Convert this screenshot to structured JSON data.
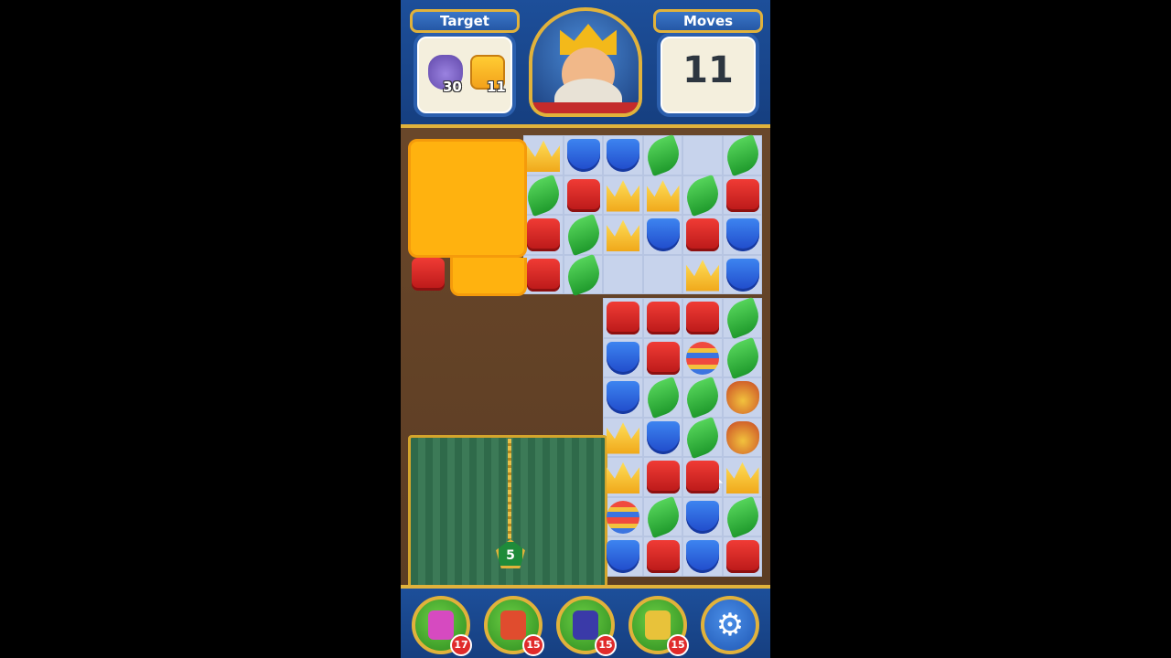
{
  "header": {
    "target_label": "Target",
    "moves_label": "Moves",
    "moves_value": "11",
    "targets": [
      {
        "icon": "vase-icon",
        "count": "30"
      },
      {
        "icon": "amber-tile-icon",
        "count": "11"
      }
    ],
    "avatar": "king-avatar"
  },
  "board": {
    "lock_count": "5",
    "pieces": [
      [
        "red",
        1,
        3
      ],
      [
        "crown",
        3,
        0
      ],
      [
        "blue",
        4,
        0
      ],
      [
        "blue",
        5,
        0
      ],
      [
        "green",
        6,
        0
      ],
      [
        "green",
        8,
        0
      ],
      [
        "green",
        3,
        1
      ],
      [
        "red",
        4,
        1
      ],
      [
        "crown",
        5,
        1
      ],
      [
        "crown",
        6,
        1
      ],
      [
        "green",
        7,
        1
      ],
      [
        "red",
        8,
        1
      ],
      [
        "red",
        3,
        2
      ],
      [
        "green",
        4,
        2
      ],
      [
        "crown",
        5,
        2
      ],
      [
        "blue",
        6,
        2
      ],
      [
        "red",
        7,
        2
      ],
      [
        "blue",
        8,
        2
      ],
      [
        "red",
        3,
        3
      ],
      [
        "green",
        4,
        3
      ],
      [
        "crown",
        7,
        3
      ],
      [
        "blue",
        8,
        3
      ],
      [
        "red",
        5,
        4
      ],
      [
        "red",
        6,
        4
      ],
      [
        "red",
        7,
        4
      ],
      [
        "green",
        8,
        4
      ],
      [
        "blue",
        5,
        5
      ],
      [
        "red",
        6,
        5
      ],
      [
        "rocket",
        7,
        5
      ],
      [
        "green",
        8,
        5
      ],
      [
        "blue",
        5,
        6
      ],
      [
        "green",
        6,
        6
      ],
      [
        "green",
        7,
        6
      ],
      [
        "jester",
        8,
        6
      ],
      [
        "crown",
        5,
        7
      ],
      [
        "blue",
        6,
        7
      ],
      [
        "green",
        7,
        7
      ],
      [
        "jester",
        8,
        7
      ],
      [
        "crown",
        5,
        8
      ],
      [
        "red",
        6,
        8
      ],
      [
        "red",
        7,
        8
      ],
      [
        "crown",
        8,
        8
      ],
      [
        "rocket",
        5,
        9
      ],
      [
        "green",
        6,
        9
      ],
      [
        "blue",
        7,
        9
      ],
      [
        "green",
        8,
        9
      ],
      [
        "blue",
        5,
        10
      ],
      [
        "red",
        6,
        10
      ],
      [
        "blue",
        7,
        10
      ],
      [
        "red",
        8,
        10
      ]
    ]
  },
  "boosters": [
    {
      "name": "hammer-booster",
      "count": "17",
      "color": "#d64ac0"
    },
    {
      "name": "arrow-booster",
      "count": "15",
      "color": "#e04c2e"
    },
    {
      "name": "cannon-booster",
      "count": "15",
      "color": "#3a3aa8"
    },
    {
      "name": "jester-hat-booster",
      "count": "15",
      "color": "#e8c23a"
    }
  ],
  "settings": {
    "icon": "gear-icon",
    "glyph": "⚙"
  }
}
